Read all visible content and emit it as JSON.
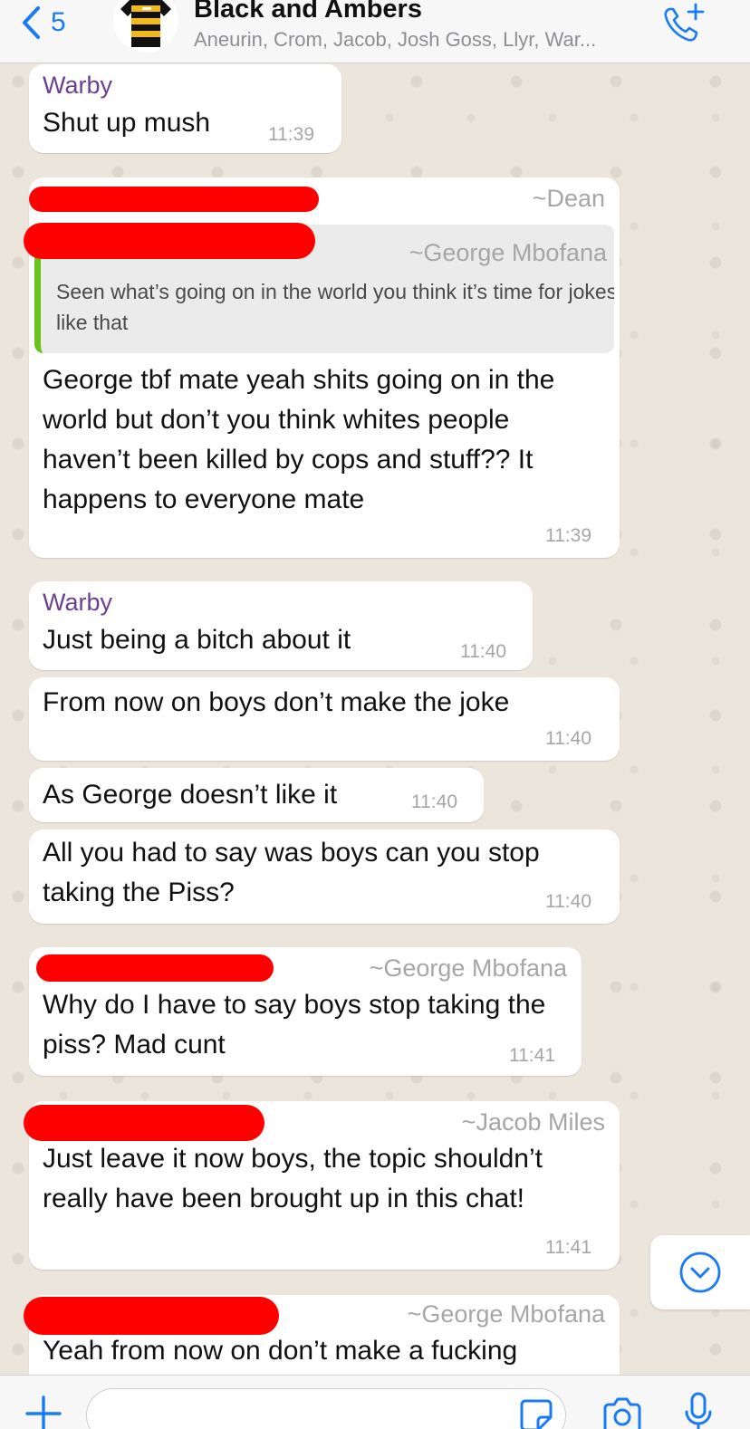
{
  "header": {
    "back_count": "5",
    "group_name": "Black and Ambers",
    "members": "Aneurin, Crom, Jacob, Josh Goss, Llyr, War...",
    "accent_color": "#1a7cf5"
  },
  "messages": [
    {
      "sender": "Warby",
      "text": "Shut up mush",
      "time": "11:39"
    },
    {
      "sender_name": "~Dean",
      "quote": {
        "author": "~George Mbofana",
        "text": "Seen what’s going on in the world you think it’s time for jokes like that"
      },
      "text": "George tbf mate yeah shits going on in the world but don’t you think whites people haven’t been killed by cops and stuff?? It happens to everyone mate",
      "time": "11:39"
    },
    {
      "sender": "Warby",
      "text": "Just being a bitch about it",
      "time": "11:40"
    },
    {
      "text": "From now on boys don’t make the joke",
      "time": "11:40"
    },
    {
      "text": "As George doesn’t like it",
      "time": "11:40"
    },
    {
      "text": "All you had to say was boys can you stop taking the Piss?",
      "time": "11:40"
    },
    {
      "sender_name": "~George Mbofana",
      "text": "Why do I have to say boys stop taking the piss? Mad cunt",
      "time": "11:41"
    },
    {
      "sender_name": "~Jacob Miles",
      "text": "Just leave it now boys, the topic shouldn’t really have been brought up in this chat!",
      "time": "11:41"
    },
    {
      "sender_name": "~George Mbofana",
      "text": "Yeah from now on don’t make a fucking"
    }
  ],
  "icons": {
    "back": "chevron-left-icon",
    "call": "phone-add-icon",
    "scroll": "chevron-down-circle-icon",
    "plus": "plus-icon",
    "sticker": "sticker-icon",
    "camera": "camera-icon",
    "mic": "microphone-icon"
  },
  "colors": {
    "sender_purple": "#6b3f91",
    "quote_bar": "#6ac31c",
    "redaction": "#ff0000",
    "chat_background": "#ece5dc"
  }
}
